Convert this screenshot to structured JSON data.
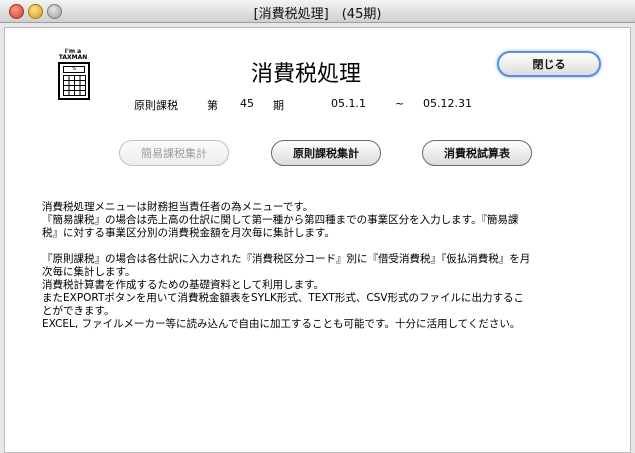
{
  "window": {
    "title": "[消費税処理]　(45期)"
  },
  "logo": {
    "line1": "I'm a",
    "line2": "TAXMAN",
    "symbol": "%"
  },
  "heading": "消費税処理",
  "buttons": {
    "close": "閉じる",
    "simple": "簡易課税集計",
    "principle": "原則課税集計",
    "trial": "消費税試算表"
  },
  "info": {
    "method": "原則課税",
    "term_label": "第",
    "term_value": "45",
    "term_unit": "期",
    "date_from": "05.1.1",
    "tilde": "~",
    "date_to": "05.12.31"
  },
  "description": {
    "para1": [
      "消費税処理メニューは財務担当責任者の為メニューです。",
      "『簡易課税』の場合は売上高の仕訳に関して第一種から第四種までの事業区分を入力します。『簡易課",
      "税』に対する事業区分別の消費税金額を月次毎に集計します。"
    ],
    "para2": [
      "『原則課税』の場合は各仕訳に入力された『消費税区分コード』別に『借受消費税』『仮払消費税』を月",
      "次毎に集計します。",
      "消費税計算書を作成するための基礎資料として利用します。",
      "またEXPORTボタンを用いて消費税金額表をSYLK形式、TEXT形式、CSV形式のファイルに出力するこ",
      "とができます。",
      "EXCEL, ファイルメーカー等に読み込んで自由に加工することも可能です。十分に活用してください。"
    ]
  }
}
